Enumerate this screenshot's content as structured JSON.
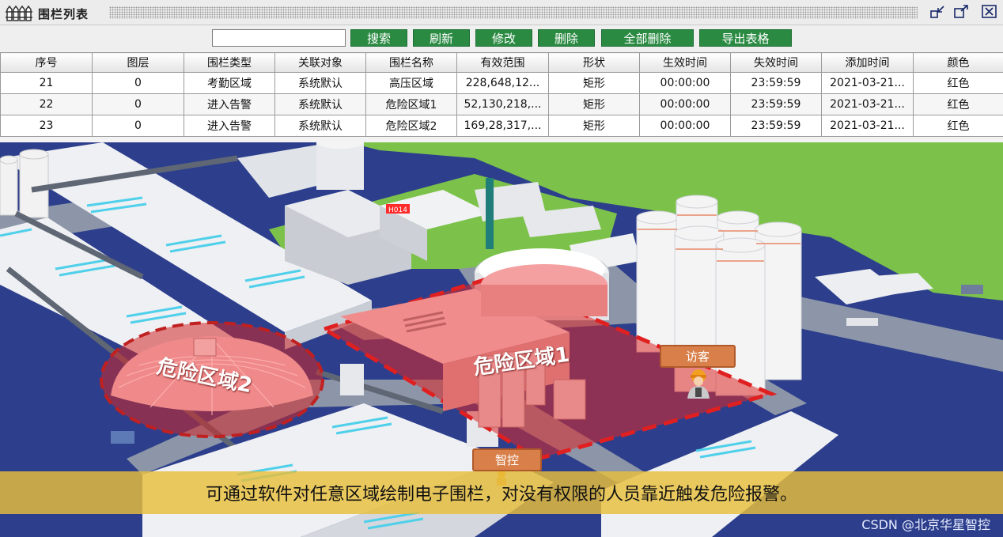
{
  "window": {
    "title": "围栏列表",
    "icon": "fence-icon"
  },
  "toolbar": {
    "search": {
      "value": "",
      "placeholder": ""
    },
    "buttons": [
      "搜索",
      "刷新",
      "修改",
      "删除",
      "全部删除",
      "导出表格"
    ]
  },
  "table": {
    "columns": [
      "序号",
      "图层",
      "围栏类型",
      "关联对象",
      "围栏名称",
      "有效范围",
      "形状",
      "生效时间",
      "失效时间",
      "添加时间",
      "颜色"
    ],
    "rows": [
      [
        "21",
        "0",
        "考勤区域",
        "系统默认",
        "高压区域",
        "228,648,12...",
        "矩形",
        "00:00:00",
        "23:59:59",
        "2021-03-21...",
        "红色"
      ],
      [
        "22",
        "0",
        "进入告警",
        "系统默认",
        "危险区域1",
        "52,130,218,...",
        "矩形",
        "00:00:00",
        "23:59:59",
        "2021-03-21...",
        "红色"
      ],
      [
        "23",
        "0",
        "进入告警",
        "系统默认",
        "危险区域2",
        "169,28,317,...",
        "矩形",
        "00:00:00",
        "23:59:59",
        "2021-03-21...",
        "红色"
      ]
    ]
  },
  "scene": {
    "zone1_label": "危险区域1",
    "zone2_label": "危险区域2",
    "visitor_label": "访客",
    "control_label": "智控",
    "building_tag": "H014",
    "subtitle": "可通过软件对任意区域绘制电子围栏，对没有权限的人员靠近触发危险报警。",
    "watermark": "CSDN @北京华星智控"
  },
  "colors": {
    "button_green": "#2a8a42",
    "zone_red": "#e03030",
    "water_blue": "#2c3e8a",
    "grass_green": "#7cc24a"
  }
}
